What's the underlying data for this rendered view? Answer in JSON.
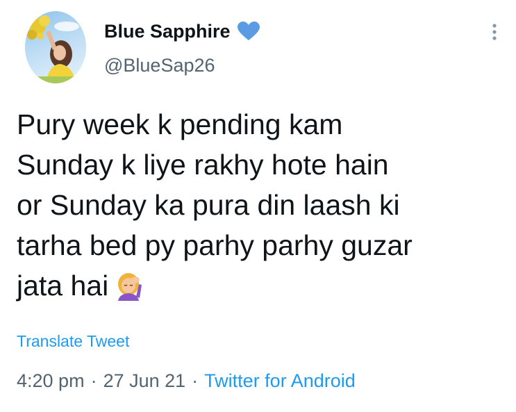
{
  "author": {
    "display_name": "Blue Sapphire",
    "handle": "@BlueSap26",
    "badge_icon": "blue-heart-icon",
    "avatar_icon": "profile-photo"
  },
  "tweet": {
    "text": "Pury week k pending kam\nSunday k liye rakhy hote hain\nor Sunday ka pura din laash ki\ntarha bed py parhy parhy guzar\njata hai",
    "trailing_emoji_icon": "woman-facepalming-icon"
  },
  "actions": {
    "translate_label": "Translate Tweet",
    "more_icon": "more-vertical-icon"
  },
  "meta": {
    "time": "4:20 pm",
    "separator": "·",
    "date": "27 Jun 21",
    "source": "Twitter for Android"
  },
  "colors": {
    "link": "#1d9bf0",
    "secondary_text": "#536471",
    "primary_text": "#0f1419",
    "heart": "#5b9be4"
  }
}
